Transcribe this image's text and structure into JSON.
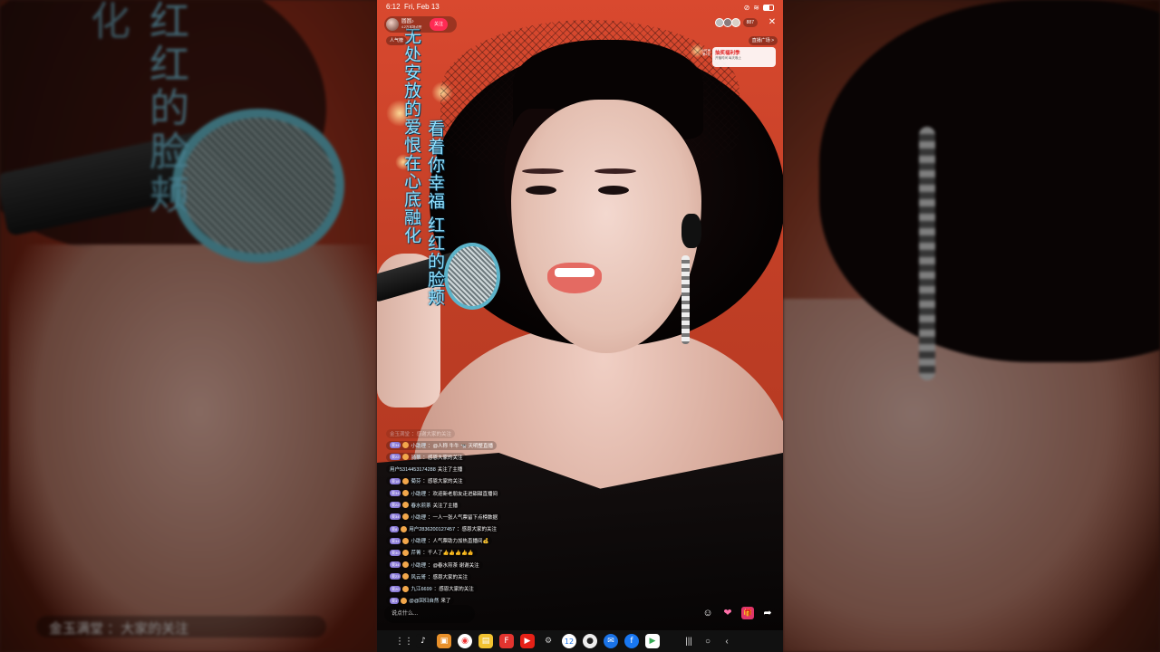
{
  "status_bar": {
    "time": "6:12",
    "date": "Fri, Feb 13"
  },
  "host": {
    "name": "圆圆♪",
    "subtitle": "4.2万本场点赞",
    "follow_label": "关注",
    "rank_label": "人气榜"
  },
  "viewers": {
    "count": "887",
    "close_icon": "close-icon"
  },
  "plaza_label": "直播广场 >",
  "promo": {
    "title": "抽奖福利季",
    "subtitle": "开播时间 每天晚上",
    "side_tag_1": "小时榜",
    "side_tag_2": "第2名"
  },
  "lyrics": {
    "line1": "无处安放的爱恨在心底融化",
    "line2": "看着你幸福 红红的脸颊"
  },
  "comments": [
    {
      "level": "",
      "user": "金玉满堂",
      "text": "：感谢大家的关注",
      "fade": true
    },
    {
      "level": "荣34",
      "user": "小助理",
      "text": "：@人称 牛牛 🐄 天明整直播"
    },
    {
      "level": "荣22",
      "user": "骑蒂",
      "text": "：感恩大家的关注"
    },
    {
      "level": "",
      "user": "用户5314453174288",
      "text": " 关注了主播"
    },
    {
      "level": "荣18",
      "user": "菊芬",
      "text": "：感恩大家的关注"
    },
    {
      "level": "荣34",
      "user": "小助理",
      "text": "：欢迎新老朋友走进甜甜直播间"
    },
    {
      "level": "荣22",
      "user": "春水煎茶",
      "text": " 关注了主播"
    },
    {
      "level": "荣34",
      "user": "小助理",
      "text": "：一人一张人气票留下点榜数据"
    },
    {
      "level": "荣8",
      "user": "用户2836200127457",
      "text": "：感恩大家的关注"
    },
    {
      "level": "荣34",
      "user": "小助理",
      "text": "：人气票助力加热直播间💰"
    },
    {
      "level": "荣30",
      "user": "芹菁",
      "text": "：千人了👍👍👍👍👍"
    },
    {
      "level": "荣34",
      "user": "小助理",
      "text": "：@春水煎茶 谢谢关注"
    },
    {
      "level": "荣23",
      "user": "风云哥",
      "text": "：感恩大家的关注"
    },
    {
      "level": "荣20",
      "user": "九江6699",
      "text": "：感恩大家的关注"
    },
    {
      "level": "荣3",
      "user": "@@回归自然",
      "text": " 来了"
    }
  ],
  "input_placeholder": "说点什么...",
  "actions": [
    "emoji-icon",
    "heart-icon",
    "gift-icon",
    "share-icon"
  ],
  "taskbar": {
    "apps": [
      "tiktok-icon",
      "photos-icon",
      "chrome-icon",
      "files-icon",
      "flipboard-icon",
      "youtube-icon",
      "settings-icon",
      "calendar-icon",
      "camera-icon",
      "messages-icon",
      "facebook-icon",
      "play-store-icon"
    ],
    "calendar_day": "12"
  },
  "colors": {
    "accent": "#ff2b54",
    "lyric": "#8fe0ff",
    "background": "#c23f26"
  }
}
